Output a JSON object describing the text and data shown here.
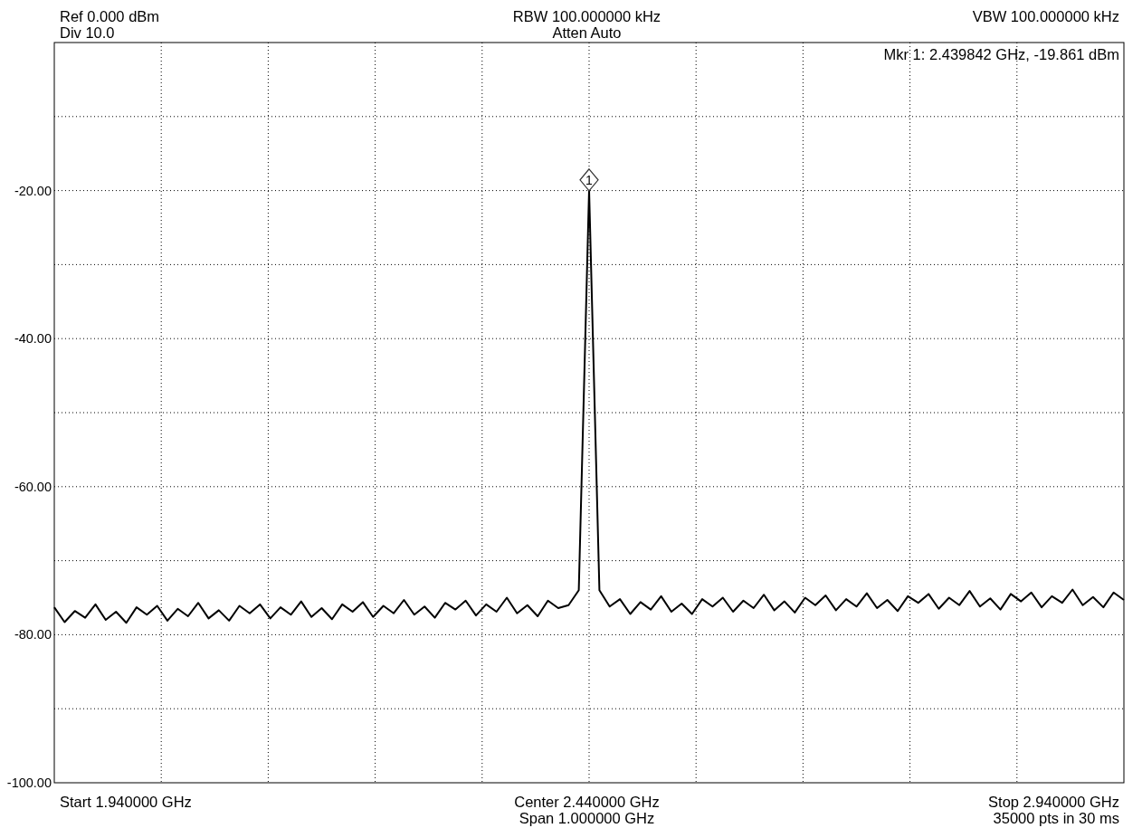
{
  "header": {
    "left": [
      "Ref 0.000 dBm",
      "Div 10.0"
    ],
    "center": [
      "RBW 100.000000 kHz",
      "Atten Auto"
    ],
    "right": [
      "VBW 100.000000 kHz"
    ]
  },
  "plot": {
    "marker_readout": "Mkr 1: 2.439842 GHz, -19.861 dBm",
    "marker": {
      "label": "1"
    },
    "chart_data": {
      "type": "line",
      "grid": true,
      "categories": [
        null,
        null,
        null,
        null,
        null,
        null,
        null,
        null,
        null,
        null,
        null,
        null,
        null,
        null,
        null,
        null,
        null,
        null,
        null,
        null,
        null,
        null,
        null,
        null,
        null,
        null,
        null,
        null,
        null,
        null,
        null,
        null,
        null,
        null,
        null,
        null,
        null,
        null,
        null,
        null,
        null,
        null,
        null,
        null,
        null,
        null,
        null,
        null,
        null,
        null,
        null,
        null,
        null,
        null,
        null,
        null,
        null,
        null,
        null,
        null,
        null,
        null,
        null,
        null,
        null,
        null,
        null,
        null,
        null,
        null,
        null,
        null,
        null,
        null,
        null,
        null,
        null,
        null,
        null,
        null,
        null,
        null,
        null,
        null,
        null,
        null,
        null,
        null,
        null,
        null,
        null,
        null,
        null,
        null,
        null,
        null,
        null,
        null,
        null,
        null,
        null,
        null,
        null,
        null,
        null
      ],
      "ylim": [
        -100,
        0
      ],
      "yticks": [
        {
          "value": -20,
          "label": "-20.00"
        },
        {
          "value": -40,
          "label": "-40.00"
        },
        {
          "value": -60,
          "label": "-60.00"
        },
        {
          "value": -80,
          "label": "-80.00"
        },
        {
          "value": -100,
          "label": "-100.00"
        }
      ],
      "series": [
        {
          "color": "#000000",
          "values": [
            -76.3,
            -78.3,
            -76.8,
            -77.7,
            -75.9,
            -78.0,
            -76.9,
            -78.4,
            -76.3,
            -77.3,
            -76.1,
            -78.1,
            -76.5,
            -77.5,
            -75.7,
            -77.8,
            -76.7,
            -78.1,
            -76.1,
            -77.1,
            -75.9,
            -77.8,
            -76.3,
            -77.3,
            -75.5,
            -77.6,
            -76.4,
            -77.9,
            -75.9,
            -76.9,
            -75.6,
            -77.6,
            -76.1,
            -77.1,
            -75.3,
            -77.3,
            -76.2,
            -77.7,
            -75.7,
            -76.6,
            -75.4,
            -77.4,
            -75.9,
            -76.9,
            -75.0,
            -77.1,
            -76.0,
            -77.5,
            -75.4,
            -76.4,
            -76.0,
            -74.0,
            -19.9,
            -74.0,
            -76.2,
            -75.2,
            -77.2,
            -75.6,
            -76.6,
            -74.8,
            -76.9,
            -75.8,
            -77.2,
            -75.2,
            -76.2,
            -75.0,
            -76.9,
            -75.4,
            -76.4,
            -74.6,
            -76.7,
            -75.5,
            -77.0,
            -75.0,
            -76.0,
            -74.7,
            -76.7,
            -75.2,
            -76.2,
            -74.4,
            -76.4,
            -75.3,
            -76.8,
            -74.8,
            -75.7,
            -74.5,
            -76.5,
            -75.0,
            -76.0,
            -74.1,
            -76.2,
            -75.1,
            -76.6,
            -74.5,
            -75.5,
            -74.3,
            -76.3,
            -74.8,
            -75.7,
            -73.9,
            -76.0,
            -74.9,
            -76.3,
            -74.3,
            -75.3
          ]
        }
      ]
    }
  },
  "footer": {
    "left": [
      "Start 1.940000 GHz"
    ],
    "center": [
      "Center 2.440000 GHz",
      "Span 1.000000 GHz"
    ],
    "right": [
      "Stop 2.940000 GHz",
      "35000 pts in 30 ms"
    ]
  }
}
